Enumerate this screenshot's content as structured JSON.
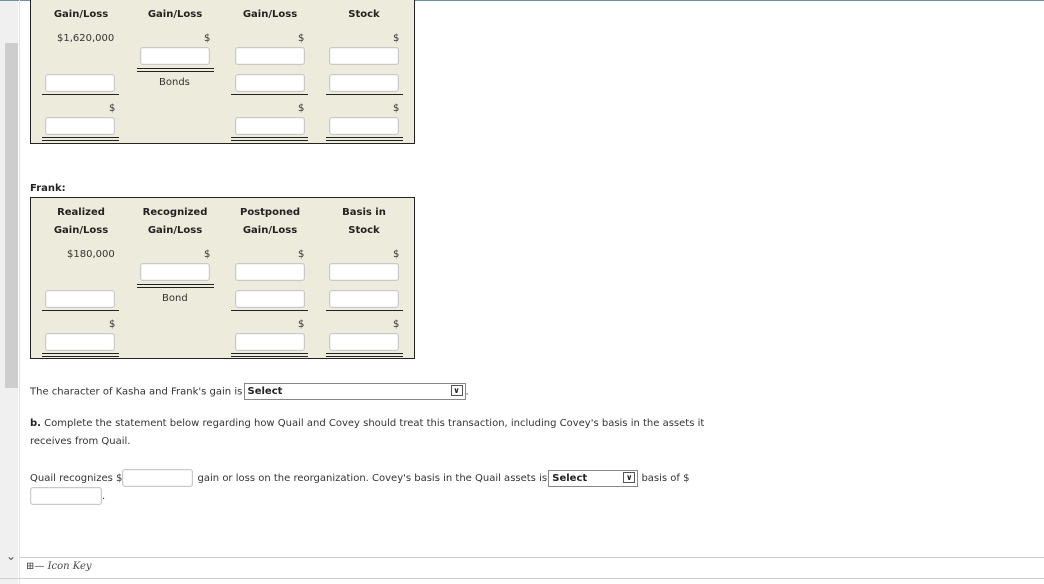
{
  "kasha_table": {
    "headers": [
      "Gain/Loss",
      "Gain/Loss",
      "Gain/Loss",
      "Stock"
    ],
    "realized_value": "$1,620,000",
    "dollar": "$",
    "recognized_label": "Bonds"
  },
  "frank": {
    "section_label": "Frank:",
    "headers": [
      {
        "line1": "Realized",
        "line2": "Gain/Loss"
      },
      {
        "line1": "Recognized",
        "line2": "Gain/Loss"
      },
      {
        "line1": "Postponed",
        "line2": "Gain/Loss"
      },
      {
        "line1": "Basis in",
        "line2": "Stock"
      }
    ],
    "realized_value": "$180,000",
    "dollar": "$",
    "recognized_label": "Bond"
  },
  "character_statement": {
    "text": "The character of Kasha and Frank's gain is",
    "select_value": "Select",
    "suffix": "."
  },
  "part_b": {
    "label": "b.",
    "text_line1": "Complete the statement below regarding how Quail and Covey should treat this transaction, including Covey's basis in the assets it",
    "text_line2": "receives from Quail."
  },
  "quail_statement": {
    "prefix": "Quail recognizes $",
    "middle": "gain or loss on the reorganization. Covey's basis in the Quail assets is",
    "select_value": "Select",
    "suffix": "basis of $",
    "end": "."
  },
  "footer": {
    "icon_key_label": "Icon Key"
  },
  "icons": {
    "chevron": "chevron-down-icon",
    "key": "key-icon"
  }
}
